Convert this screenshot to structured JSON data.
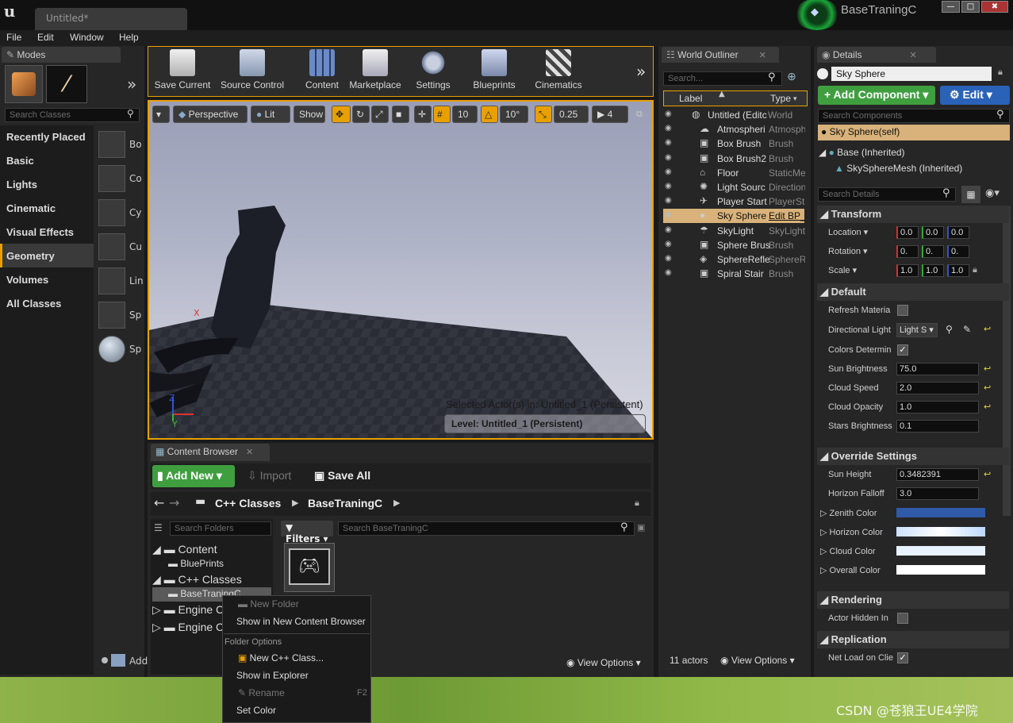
{
  "window": {
    "tab_title": "Untitled*",
    "project_name": "BaseTraningC",
    "minimize": "—",
    "maximize": "□",
    "close": "✖"
  },
  "menu": [
    "File",
    "Edit",
    "Window",
    "Help"
  ],
  "modes": {
    "tab": "Modes",
    "search_placeholder": "Search Classes",
    "categories": [
      "Recently Placed",
      "Basic",
      "Lights",
      "Cinematic",
      "Visual Effects",
      "Geometry",
      "Volumes",
      "All Classes"
    ],
    "selected_category": "Geometry",
    "items": [
      "Bo",
      "Co",
      "Cy",
      "Cu",
      "Lin",
      "Sp",
      "Sp"
    ],
    "add_label": "Add"
  },
  "toolbar": {
    "buttons": [
      "Save Current",
      "Source Control",
      "Content",
      "Marketplace",
      "Settings",
      "Blueprints",
      "Cinematics"
    ]
  },
  "viewport": {
    "perspective": "Perspective",
    "lit": "Lit",
    "show": "Show",
    "grid_snap": "10",
    "rot_snap": "10°",
    "scale_snap": "0.25",
    "cam_speed": "4",
    "selected_actor_text": "Selected Actor(s) in:  Untitled_1 (Persistent)",
    "level_text": "Level:  Untitled_1 (Persistent)",
    "axis_x": "X",
    "axis_y": "Y",
    "axis_z": "Z"
  },
  "content_browser": {
    "tab": "Content Browser",
    "add_new": "Add New",
    "import": "Import",
    "save_all": "Save All",
    "path": [
      "C++ Classes",
      "BaseTraningC"
    ],
    "search_folders": "Search Folders",
    "filters": "Filters",
    "search_assets": "Search BaseTraningC",
    "tree": [
      "Content",
      "BluePrints",
      "C++ Classes",
      "BaseTraningC",
      "Engine C",
      "Engine C"
    ],
    "view_options": "View Options"
  },
  "context_menu": {
    "new_folder": "New Folder",
    "show_in_new_cb": "Show in New Content Browser",
    "section": "Folder Options",
    "new_cpp": "New C++ Class...",
    "show_explorer": "Show in Explorer",
    "rename": "Rename",
    "rename_key": "F2",
    "set_color": "Set Color"
  },
  "outliner": {
    "tab": "World Outliner",
    "search_placeholder": "Search...",
    "col_label": "Label",
    "col_type": "Type",
    "rows": [
      {
        "label": "Untitled (Editc",
        "type": "World"
      },
      {
        "label": "Atmospheri",
        "type": "Atmosph"
      },
      {
        "label": "Box Brush",
        "type": "Brush"
      },
      {
        "label": "Box Brush2",
        "type": "Brush"
      },
      {
        "label": "Floor",
        "type": "StaticMe"
      },
      {
        "label": "Light Sourc",
        "type": "Direction"
      },
      {
        "label": "Player Start",
        "type": "PlayerSt"
      },
      {
        "label": "Sky Sphere",
        "type": "Edit BP_"
      },
      {
        "label": "SkyLight",
        "type": "SkyLight"
      },
      {
        "label": "Sphere Brus",
        "type": "Brush"
      },
      {
        "label": "SphereRefle",
        "type": "SphereR"
      },
      {
        "label": "Spiral Stair",
        "type": "Brush"
      }
    ],
    "count": "11 actors",
    "view_options": "View Options"
  },
  "details": {
    "tab": "Details",
    "name": "Sky Sphere",
    "add_component": "Add Component",
    "edit": "Edit",
    "search_components": "Search Components",
    "self_item": "Sky Sphere(self)",
    "base_item": "Base (Inherited)",
    "mesh_item": "SkySphereMesh (Inherited)",
    "search_details": "Search Details",
    "transform": "Transform",
    "location": "Location",
    "rotation": "Rotation",
    "scale": "Scale",
    "loc": [
      "0.0",
      "0.0",
      "0.0"
    ],
    "rot": [
      "0.",
      "0.",
      "0."
    ],
    "scl": [
      "1.0",
      "1.0",
      "1.0"
    ],
    "default": "Default",
    "refresh": "Refresh Materia",
    "dir_light": "Directional Light",
    "dir_light_val": "Light S",
    "colors_det": "Colors Determin",
    "sun_brightness": "Sun Brightness",
    "sun_brightness_val": "75.0",
    "cloud_speed": "Cloud Speed",
    "cloud_speed_val": "2.0",
    "cloud_opacity": "Cloud Opacity",
    "cloud_opacity_val": "1.0",
    "stars": "Stars Brightness",
    "stars_val": "0.1",
    "override": "Override Settings",
    "sun_height": "Sun Height",
    "sun_height_val": "0.3482391",
    "horizon_falloff": "Horizon Falloff",
    "horizon_falloff_val": "3.0",
    "zenith": "Zenith Color",
    "horizon": "Horizon Color",
    "cloud_color": "Cloud Color",
    "overall": "Overall Color",
    "rendering": "Rendering",
    "actor_hidden": "Actor Hidden In",
    "replication": "Replication",
    "net_load": "Net Load on Clie"
  },
  "watermark": "CSDN @苍狼王UE4学院",
  "colors": {
    "accent_orange": "#e8a000",
    "green_button": "#3f9f3f",
    "blue_button": "#2a62b8",
    "zenith": "#2f5aa8"
  }
}
